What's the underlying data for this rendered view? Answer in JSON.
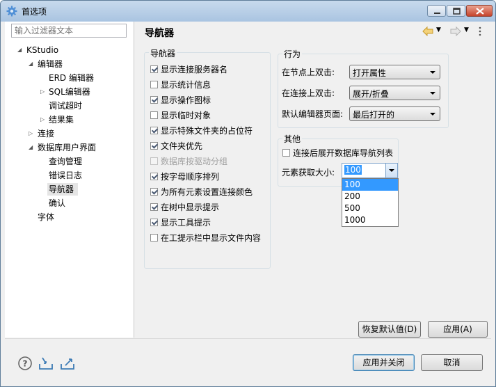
{
  "window": {
    "title": "首选项"
  },
  "filter": {
    "placeholder": "输入过滤器文本"
  },
  "tree": [
    {
      "label": "KStudio"
    },
    {
      "label": "编辑器"
    },
    {
      "label": "ERD 编辑器"
    },
    {
      "label": "SQL编辑器"
    },
    {
      "label": "调试超时"
    },
    {
      "label": "结果集"
    },
    {
      "label": "连接"
    },
    {
      "label": "数据库用户界面"
    },
    {
      "label": "查询管理"
    },
    {
      "label": "错误日志"
    },
    {
      "label": "导航器"
    },
    {
      "label": "确认"
    },
    {
      "label": "字体"
    }
  ],
  "page": {
    "title": "导航器"
  },
  "navgroup": {
    "title": "导航器",
    "items": [
      {
        "label": "显示连接服务器名",
        "checked": true
      },
      {
        "label": "显示统计信息",
        "checked": false
      },
      {
        "label": "显示操作图标",
        "checked": true
      },
      {
        "label": "显示临时对象",
        "checked": false
      },
      {
        "label": "显示特殊文件夹的占位符",
        "checked": true
      },
      {
        "label": "文件夹优先",
        "checked": true
      },
      {
        "label": "数据库按驱动分组",
        "checked": false,
        "disabled": true
      },
      {
        "label": "按字母顺序排列",
        "checked": true
      },
      {
        "label": "为所有元素设置连接颜色",
        "checked": true
      },
      {
        "label": "在树中显示提示",
        "checked": true
      },
      {
        "label": "显示工具提示",
        "checked": true
      },
      {
        "label": "在工提示栏中显示文件内容",
        "checked": false
      }
    ]
  },
  "behavior": {
    "title": "行为",
    "rows": [
      {
        "label": "在节点上双击:",
        "value": "打开属性"
      },
      {
        "label": "在连接上双击:",
        "value": "展开/折叠"
      },
      {
        "label": "默认编辑器页面:",
        "value": "最后打开的"
      }
    ]
  },
  "other": {
    "title": "其他",
    "expand_label": "连接后展开数据库导航列表",
    "expand_checked": false,
    "fetch_label": "元素获取大小:",
    "fetch_value": "100",
    "fetch_options": [
      "100",
      "200",
      "500",
      "1000"
    ]
  },
  "buttons": {
    "restore": "恢复默认值(D)",
    "apply": "应用(A)",
    "apply_close": "应用并关闭",
    "cancel": "取消"
  },
  "colors": {
    "accent": "#3399ff",
    "titlebar": "#b9d1ea",
    "close": "#c6432b"
  },
  "icons": [
    "help-icon",
    "import-icon",
    "export-icon",
    "back-icon",
    "forward-icon",
    "menu-icon"
  ]
}
